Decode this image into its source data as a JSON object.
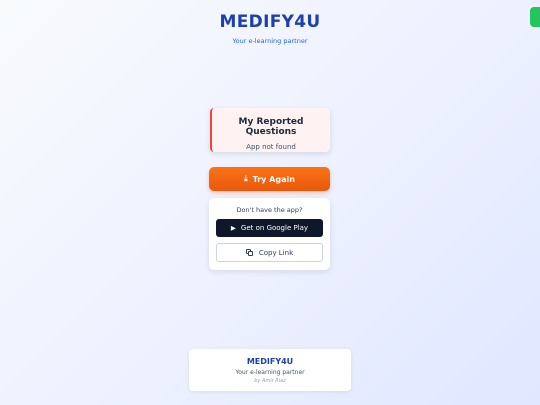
{
  "header": {
    "brand": "MEDIFY4U",
    "tagline": "Your e-learning partner"
  },
  "error_card": {
    "title": "My Reported Questions",
    "message": "App not found"
  },
  "actions": {
    "try_again_label": "Try Again",
    "try_again_icon": "download-icon"
  },
  "app_prompt": {
    "question": "Don't have the app?",
    "play_label": "Get on Google Play",
    "play_icon": "play-icon",
    "copy_label": "Copy Link",
    "copy_icon": "copy-icon"
  },
  "footer": {
    "brand": "MEDIFY4U",
    "tagline": "Your e-learning partner",
    "author": "by Amir Riaz"
  },
  "colors": {
    "brand": "#1e40af",
    "accent_orange": "#f97316",
    "error_border": "#ef4444",
    "dark_button": "#0f172a",
    "corner_tab": "#22c55e"
  }
}
